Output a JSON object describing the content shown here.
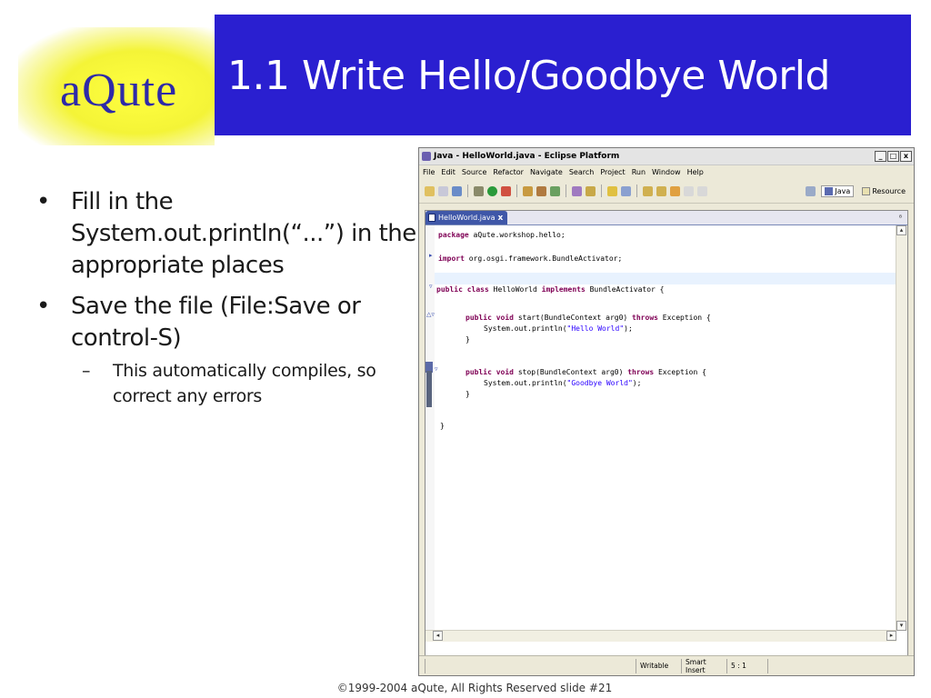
{
  "logo": {
    "text": "aQute",
    "glow_color": "#f4f437",
    "text_color": "#2e2aa8"
  },
  "title": {
    "text": "1.1 Write Hello/Goodbye World",
    "banner_color": "#2a1fd0"
  },
  "bullets": [
    {
      "text": "Fill in the System.out.println(“...”) in the appropriate places"
    },
    {
      "text": "Save the file (File:Save or control-S)",
      "sub": {
        "text": "This automatically compiles, so correct any errors"
      }
    }
  ],
  "bullet_glyph": "•",
  "sub_glyph": "–",
  "eclipse": {
    "window_title": "Java - HelloWorld.java - Eclipse Platform",
    "window_buttons": [
      "_",
      "□",
      "x"
    ],
    "menu": [
      "File",
      "Edit",
      "Source",
      "Refactor",
      "Navigate",
      "Search",
      "Project",
      "Run",
      "Window",
      "Help"
    ],
    "perspectives": [
      {
        "label": "Java",
        "active": true
      },
      {
        "label": "Resource",
        "active": false
      }
    ],
    "editor_tab": {
      "label": "HelloWorld.java",
      "close": "x"
    },
    "editor_max_icon": "⁸",
    "code": {
      "l1_kw": "package",
      "l1_rest": " aQute.workshop.hello;",
      "l2_kw": "import",
      "l2_rest": " org.osgi.framework.BundleActivator;",
      "l3_a": "public",
      "l3_b": " ",
      "l3_c": "class",
      "l3_d": " HelloWorld ",
      "l3_e": "implements",
      "l3_f": " BundleActivator {",
      "l4_a": "public",
      "l4_b": "void",
      "l4_c": " start(BundleContext arg0) ",
      "l4_d": "throws",
      "l4_e": " Exception {",
      "l5_a": "System.out.println(",
      "l5_b": "\"Hello World\"",
      "l5_c": ");",
      "l6": "}",
      "l7_a": "public",
      "l7_b": "void",
      "l7_c": " stop(BundleContext arg0) ",
      "l7_d": "throws",
      "l7_e": " Exception {",
      "l8_a": "System.out.println(",
      "l8_b": "\"Goodbye World\"",
      "l8_c": ");",
      "l9": "}",
      "l10": "}"
    },
    "status": {
      "writable": "Writable",
      "insert_mode": "Smart Insert",
      "position": "5 : 1"
    },
    "colors": {
      "keyword": "#7f0055",
      "string": "#2a00ff",
      "tab_active": "#3f57a8"
    }
  },
  "footer": {
    "text": "©1999-2004 aQute, All Rights Reserved  slide #21"
  }
}
